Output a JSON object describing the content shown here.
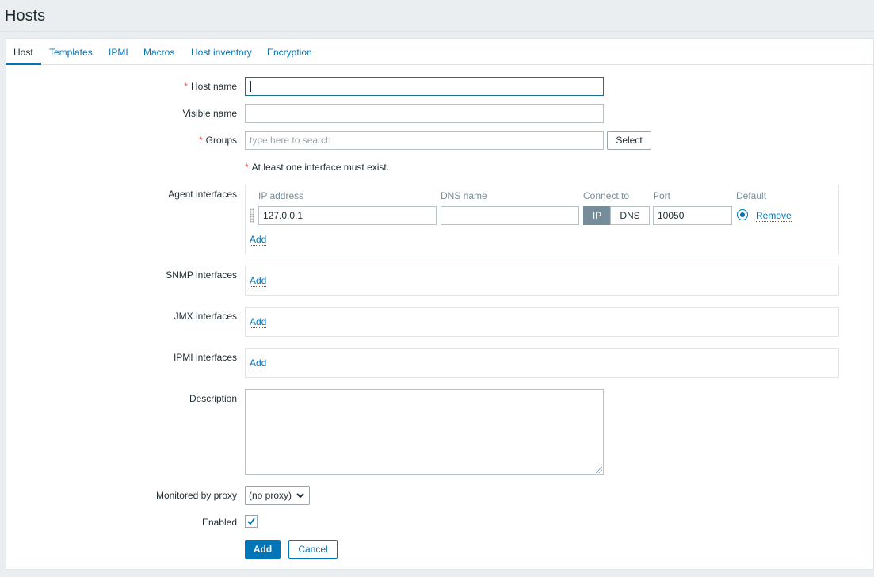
{
  "page": {
    "title": "Hosts"
  },
  "tabs": [
    {
      "label": "Host",
      "active": true
    },
    {
      "label": "Templates",
      "active": false
    },
    {
      "label": "IPMI",
      "active": false
    },
    {
      "label": "Macros",
      "active": false
    },
    {
      "label": "Host inventory",
      "active": false
    },
    {
      "label": "Encryption",
      "active": false
    }
  ],
  "form": {
    "host_name": {
      "label": "Host name",
      "required": true,
      "value": ""
    },
    "visible_name": {
      "label": "Visible name",
      "value": ""
    },
    "groups": {
      "label": "Groups",
      "required": true,
      "placeholder": "type here to search",
      "select_label": "Select"
    },
    "interface_warning": "At least one interface must exist.",
    "agent_interfaces": {
      "label": "Agent interfaces",
      "columns": {
        "ip": "IP address",
        "dns": "DNS name",
        "connect": "Connect to",
        "port": "Port",
        "default": "Default"
      },
      "rows": [
        {
          "ip": "127.0.0.1",
          "dns": "",
          "connect_options": [
            "IP",
            "DNS"
          ],
          "connect_selected": "IP",
          "port": "10050",
          "is_default": true,
          "remove_label": "Remove"
        }
      ],
      "add_label": "Add"
    },
    "snmp_interfaces": {
      "label": "SNMP interfaces",
      "add_label": "Add"
    },
    "jmx_interfaces": {
      "label": "JMX interfaces",
      "add_label": "Add"
    },
    "ipmi_interfaces": {
      "label": "IPMI interfaces",
      "add_label": "Add"
    },
    "description": {
      "label": "Description",
      "value": ""
    },
    "proxy": {
      "label": "Monitored by proxy",
      "selected": "(no proxy)"
    },
    "enabled": {
      "label": "Enabled",
      "checked": true
    },
    "buttons": {
      "add": "Add",
      "cancel": "Cancel"
    }
  },
  "colors": {
    "accent": "#0275b8",
    "required": "#e45959",
    "segment_active": "#768d99"
  }
}
